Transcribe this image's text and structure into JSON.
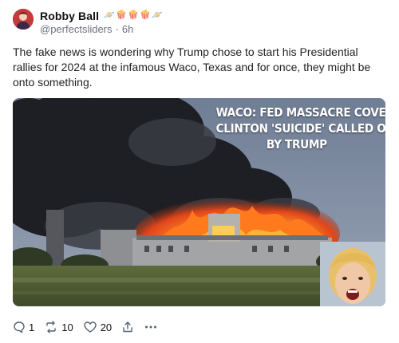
{
  "post": {
    "author": {
      "display_name": "Robby Ball",
      "handle": "@perfectsliders",
      "badges": [
        "🪐",
        "🍿",
        "🍿",
        "🍿",
        "🪐"
      ]
    },
    "separator": "·",
    "time": "6h",
    "text": "The fake news is wondering why Trump chose to start his Presidential rallies for 2024 at the infamous Waco, Texas and for once, they might be onto something.",
    "image": {
      "caption_lines": [
        "WACO: FED MASSACRE COVER UP",
        "CLINTON 'SUICIDE' CALLED OUT",
        "BY TRUMP"
      ]
    },
    "actions": {
      "replies": "1",
      "reposts": "10",
      "likes": "20"
    }
  },
  "colors": {
    "text": "#222222",
    "muted": "#6b7280",
    "icon": "#536471",
    "fire": "#ff6a1a",
    "smoke": "#1f2126",
    "sky": "#7d8aa0"
  },
  "icons": [
    "reply-icon",
    "repost-icon",
    "like-icon",
    "share-icon",
    "more-icon"
  ]
}
